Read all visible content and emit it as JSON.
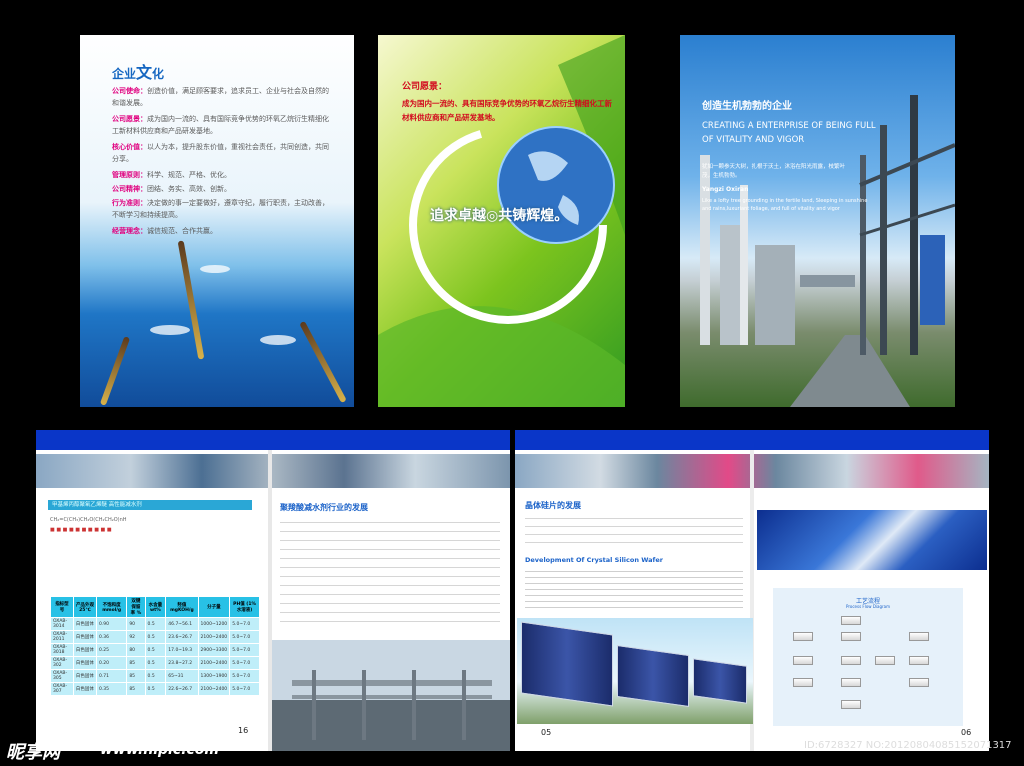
{
  "panel1": {
    "title_a": "企业",
    "title_b": "文",
    "title_c": "化",
    "items": [
      {
        "label": "公司使命：",
        "text": "创造价值，满足顾客要求，追求员工、企业与社会及自然的和谐发展。"
      },
      {
        "label": "公司愿景：",
        "text": "成为国内一流的、具有国际竞争优势的环氧乙烷衍生精细化工新材料供应商和产品研发基地。"
      },
      {
        "label": "核心价值：",
        "text": "以人为本，提升股东价值，重视社会责任，共同创造，共同分享。"
      },
      {
        "label": "管理原则：",
        "text": "科学、规范、严格、优化。"
      },
      {
        "label": "公司精神：",
        "text": "团结、务实、高效、创新。"
      },
      {
        "label": "行为准则：",
        "text": "决定做的事一定要做好，遵章守纪，履行职责，主动改善，不断学习和持续提高。"
      },
      {
        "label": "经营理念：",
        "text": "诚信规范、合作共赢。"
      }
    ]
  },
  "panel2": {
    "heading": "公司愿景：",
    "text": "成为国内一流的、具有国际竞争优势的环氧乙烷衍生精细化工新材料供应商和产品研发基地。",
    "slogan": "追求卓越◎共铸辉煌。"
  },
  "panel3": {
    "title_cn": "创造生机勃勃的企业",
    "title_en": "CREATING A ENTERPRISE OF BEING FULL OF VITALITY AND VIGOR",
    "lines_cn": "犹如一颗参天大树，扎根于沃土，沐浴在阳光雨露，枝繁叶茂，生机勃勃。",
    "yangzi": "Yangzi Oxiran",
    "lines_en": "Like a lofty tree grounding in the fertile land, Sleeping in sunshine and rains,luxuriant foliage, and full of vitality and vigor"
  },
  "left_page": {
    "table_title": "甲基烯丙醇聚氧乙烯醚 高性能减水剂",
    "formula": "CH₂=C(CH₃)CH₂O(CH₂CH₂O)nH",
    "table_headers": [
      "指标型号",
      "产品外观 25℃",
      "不饱和度 mmol/g",
      "双键保留率 %",
      "水含量 wt%",
      "羟值 mgKOH/g",
      "分子量",
      "PH值 (1%水溶液)"
    ],
    "table_rows": [
      [
        "OXAB-3014",
        "白色固体",
        "0.90",
        "90",
        "0.5",
        "46.7~56.1",
        "1000~1200",
        "5.0~7.0"
      ],
      [
        "OXAB-2011",
        "白色固体",
        "0.36",
        "92",
        "0.5",
        "23.6~26.7",
        "2100~2400",
        "5.0~7.0"
      ],
      [
        "OXAB-3018",
        "白色固体",
        "0.25",
        "80",
        "0.5",
        "17.0~19.3",
        "2900~3300",
        "5.0~7.0"
      ],
      [
        "OXAB-302",
        "白色固体",
        "0.20",
        "85",
        "0.5",
        "23.8~27.2",
        "2100~2400",
        "5.0~7.0"
      ],
      [
        "OXAB-305",
        "白色固体",
        "0.71",
        "85",
        "0.5",
        "65~31",
        "1300~1900",
        "5.0~7.0"
      ],
      [
        "OXAB-307",
        "白色固体",
        "0.35",
        "85",
        "0.5",
        "22.6~26.7",
        "2100~2400",
        "5.0~7.0"
      ]
    ],
    "section_title": "聚羧酸减水剂行业的发展",
    "page_no": "16"
  },
  "right_page": {
    "section_title": "晶体硅片的发展",
    "subtitle_en": "Development Of Crystal Silicon Wafer",
    "process_title_cn": "工艺流程",
    "process_title_en": "Process Flow Diagram",
    "page_left": "05",
    "page_right": "06"
  },
  "watermark": {
    "brand": "昵享网",
    "site": "www.nipic.com",
    "id": "ID:6728327 NO:20120804085152071317"
  },
  "colors": {
    "accent_blue": "#0a36c8",
    "section_blue": "#1c63c9",
    "label_pink": "#e0007f",
    "vision_red": "#d20a1e",
    "table_head": "#28c1e6"
  }
}
